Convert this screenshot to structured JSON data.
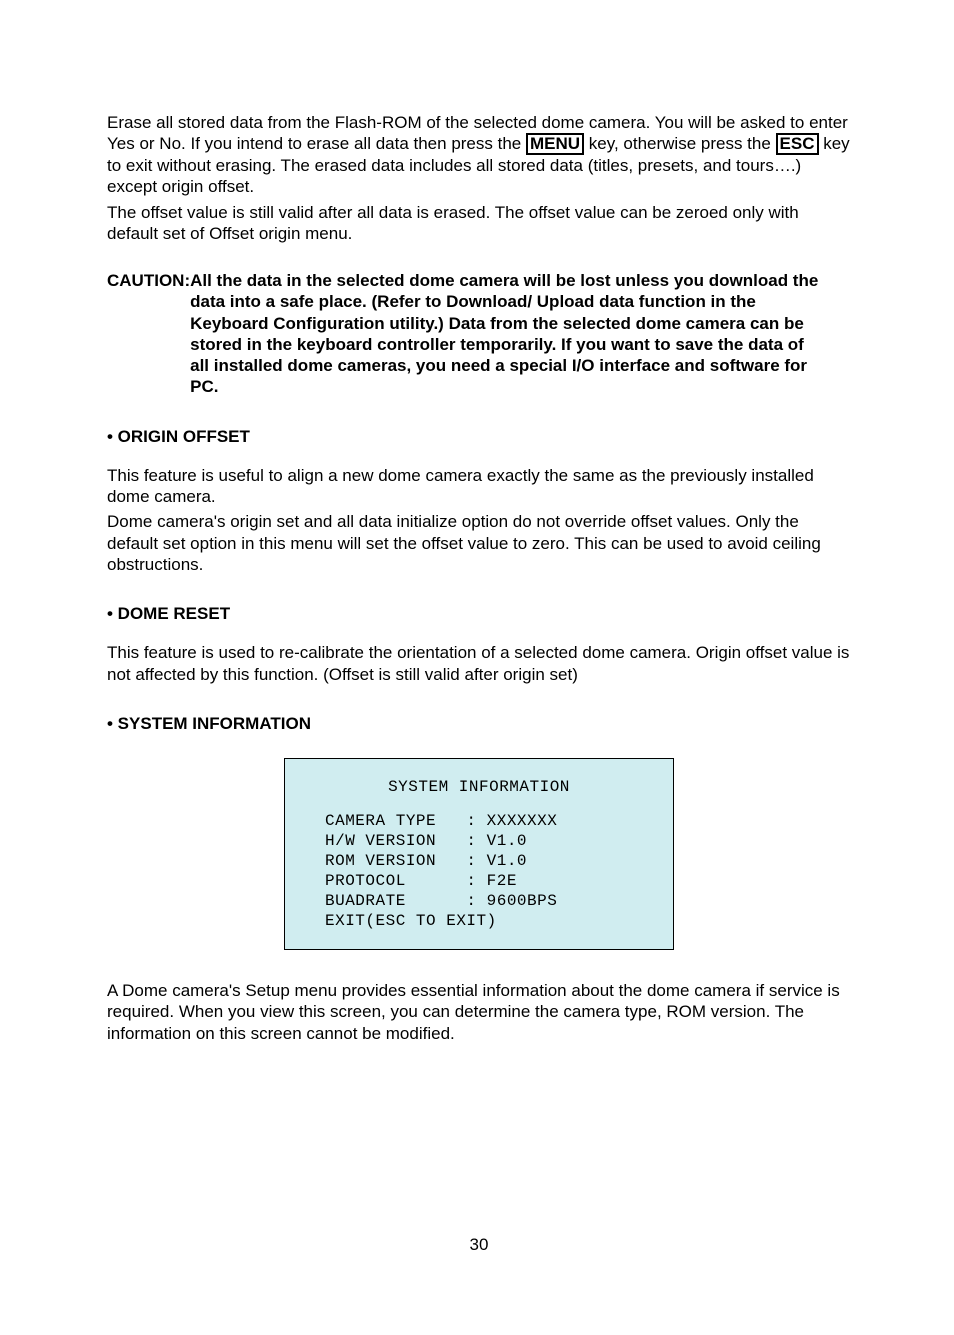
{
  "intro": {
    "p1_a": "Erase all stored data from the Flash-ROM of the selected dome camera. You will be asked to enter Yes or No. If you intend to erase all data then press the ",
    "menu_key": "MENU",
    "p1_b": " key, otherwise press the ",
    "esc_key": "ESC",
    "p1_c": " key to exit without erasing. The erased data includes all stored data (titles, presets, and tours….) except origin offset.",
    "p2": "The offset value is still valid after all data is erased. The offset value can be zeroed only with default set of Offset origin menu."
  },
  "caution": {
    "label": "CAUTION: ",
    "text": "All the data in the selected dome camera will be lost unless you download the data into a safe place. (Refer to Download/ Upload data function in the Keyboard Configuration utility.) Data from the selected dome camera can be stored in the keyboard controller temporarily. If you want to save the data of all installed dome cameras, you need a special I/O interface and software for PC."
  },
  "origin_offset": {
    "heading": "• ORIGIN OFFSET",
    "p1": "This feature is useful to align a new dome camera exactly the same as the previously installed dome camera.",
    "p2": "Dome camera's origin set and all data initialize option do not override offset values. Only the default set option in this menu will set the offset value to zero. This can be used to avoid ceiling obstructions."
  },
  "dome_reset": {
    "heading": "• DOME RESET",
    "p1": "This feature is used to re-calibrate the orientation of a selected dome camera. Origin offset value is not affected by this function. (Offset is still valid after origin set)"
  },
  "system_info": {
    "heading": "• SYSTEM INFORMATION",
    "panel": {
      "title": "SYSTEM INFORMATION",
      "l1": "CAMERA TYPE   : XXXXXXX",
      "l2": "H/W VERSION   : V1.0",
      "l3": "ROM VERSION   : V1.0",
      "l4": "PROTOCOL      : F2E",
      "l5": "BUADRATE      : 9600BPS",
      "l6": "EXIT(ESC TO EXIT)"
    },
    "p1": "A Dome camera's Setup menu provides essential information about the dome camera if service is required. When you view this screen, you can determine the camera type, ROM version. The information on this screen cannot be modified."
  },
  "page_number": "30"
}
